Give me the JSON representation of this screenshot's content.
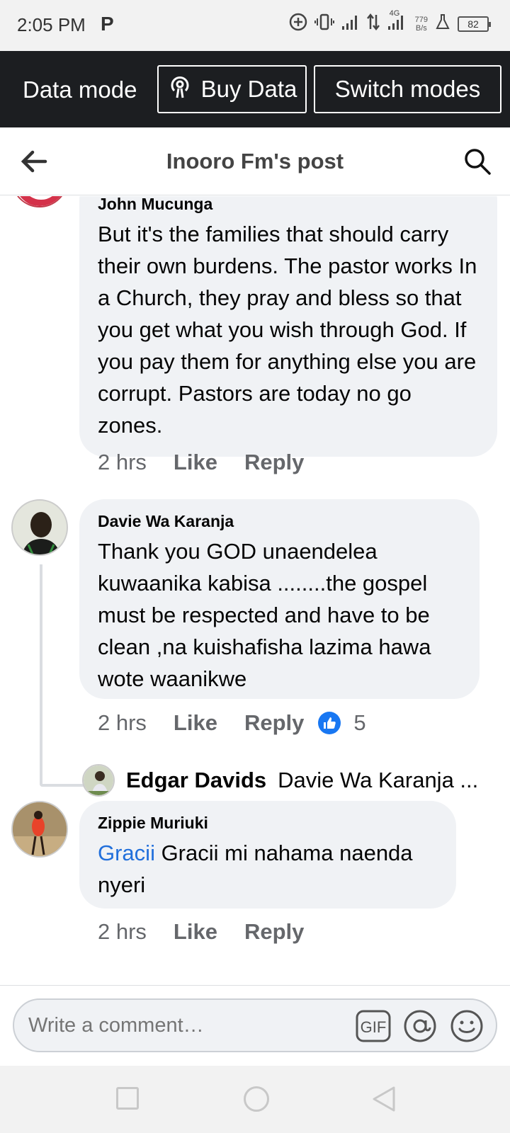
{
  "status_bar": {
    "time": "2:05 PM",
    "carrier_icon": "P",
    "network": "4G",
    "speed_value": "779",
    "speed_unit": "B/s",
    "battery": "82"
  },
  "data_bar": {
    "label": "Data mode",
    "buy_label": "Buy Data",
    "switch_label": "Switch modes"
  },
  "header": {
    "title": "Inooro Fm's post"
  },
  "comments": [
    {
      "author": "John Mucunga",
      "text": "But it's the families that should carry their own burdens. The pastor works In a Church, they pray and bless so that you get what you wish through God. If you pay them for anything else you are corrupt. Pastors are today no go zones.",
      "time": "2 hrs",
      "like": "Like",
      "reply": "Reply"
    },
    {
      "author": "Davie Wa Karanja",
      "text": "Thank you GOD unaendelea kuwaanika kabisa ........the gospel must be respected and have to be clean ,na kuishafisha lazima hawa wote waanikwe",
      "time": "2 hrs",
      "like": "Like",
      "reply": "Reply",
      "reactions": "5",
      "reply_preview": {
        "author": "Edgar Davids",
        "text": "Davie Wa Karanja ..."
      }
    },
    {
      "author": "Zippie Muriuki",
      "mention": "Gracii",
      "text": " Gracii mi nahama naenda nyeri",
      "time": "2 hrs",
      "like": "Like",
      "reply": "Reply"
    }
  ],
  "comment_input": {
    "placeholder": "Write a comment…",
    "gif_label": "GIF"
  },
  "colors": {
    "accent": "#1877f2",
    "mention": "#216fdb",
    "data_bar_bg": "#1c1e21",
    "bubble_bg": "#f0f2f5"
  }
}
